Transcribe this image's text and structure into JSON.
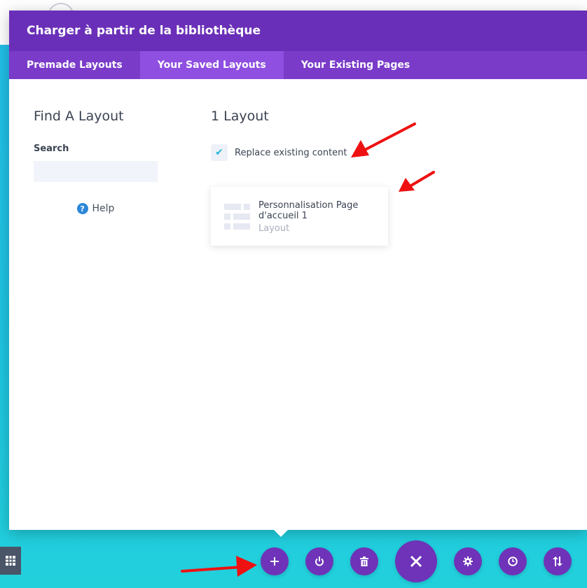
{
  "modal": {
    "title": "Charger à partir de la bibliothèque",
    "tabs": [
      {
        "label": "Premade Layouts",
        "active": false
      },
      {
        "label": "Your Saved Layouts",
        "active": true
      },
      {
        "label": "Your Existing Pages",
        "active": false
      }
    ]
  },
  "sidebar": {
    "heading": "Find A Layout",
    "search_label": "Search",
    "search_value": "",
    "help_label": "Help"
  },
  "content": {
    "count_heading": "1 Layout",
    "replace_label": "Replace existing content",
    "replace_checked": true,
    "layouts": [
      {
        "title": "Personnalisation Page d'accueil 1",
        "type": "Layout"
      }
    ]
  },
  "toolbar": {
    "buttons": [
      {
        "name": "add-button",
        "icon": "plus-icon"
      },
      {
        "name": "power-button",
        "icon": "power-icon"
      },
      {
        "name": "delete-button",
        "icon": "trash-icon"
      },
      {
        "name": "close-button",
        "icon": "close-icon"
      },
      {
        "name": "settings-button",
        "icon": "gear-icon"
      },
      {
        "name": "history-button",
        "icon": "clock-icon"
      },
      {
        "name": "portability-button",
        "icon": "sort-arrows-icon"
      }
    ]
  },
  "colors": {
    "header": "#6a2fb8",
    "tabs": "#7a3bc9",
    "active_tab": "#8f4fe0",
    "accent": "#27b6d9",
    "toolbar_button": "#6e33b8",
    "annotation_arrow": "#ee1111"
  }
}
